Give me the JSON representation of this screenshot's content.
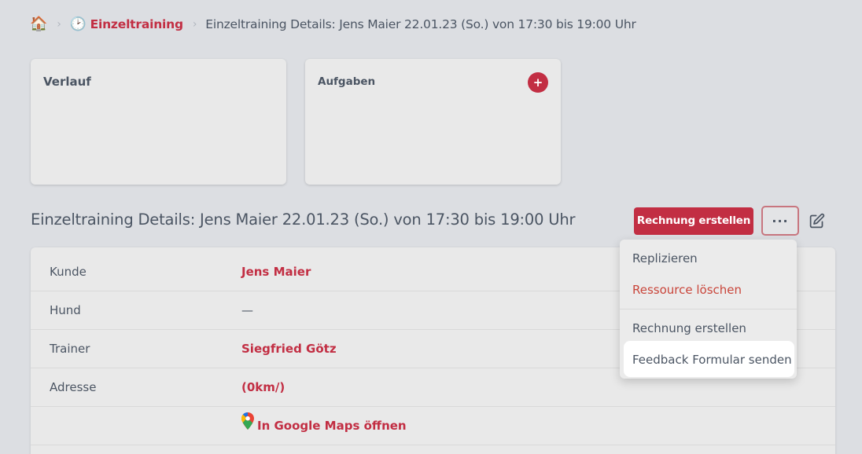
{
  "breadcrumb": {
    "home_icon": "🏠",
    "clock_icon": "🕑",
    "parent": "Einzeltraining",
    "current": "Einzeltraining Details: Jens Maier 22.01.23 (So.) von 17:30 bis 19:00 Uhr"
  },
  "cards": {
    "verlauf_title": "Verlauf",
    "aufgaben_title": "Aufgaben",
    "add_label": "+"
  },
  "section": {
    "title": "Einzeltraining Details: Jens Maier 22.01.23 (So.) von 17:30 bis 19:00 Uhr",
    "rechnung_button": "Rechnung erstellen",
    "more_button": "···"
  },
  "details": {
    "rows": [
      {
        "label": "Kunde",
        "value": "Jens Maier"
      },
      {
        "label": "Hund",
        "value": "—"
      },
      {
        "label": "Trainer",
        "value": "Siegfried Götz"
      },
      {
        "label": "Adresse",
        "value": "(0km/)"
      },
      {
        "label": "",
        "value": "In Google Maps öffnen"
      }
    ]
  },
  "dropdown": {
    "items": [
      "Replizieren",
      "Ressource löschen",
      "Rechnung erstellen",
      "Feedback Formular senden"
    ]
  },
  "colors": {
    "accent": "#c22e43",
    "danger": "#c9453a",
    "background": "#dcdee2"
  }
}
